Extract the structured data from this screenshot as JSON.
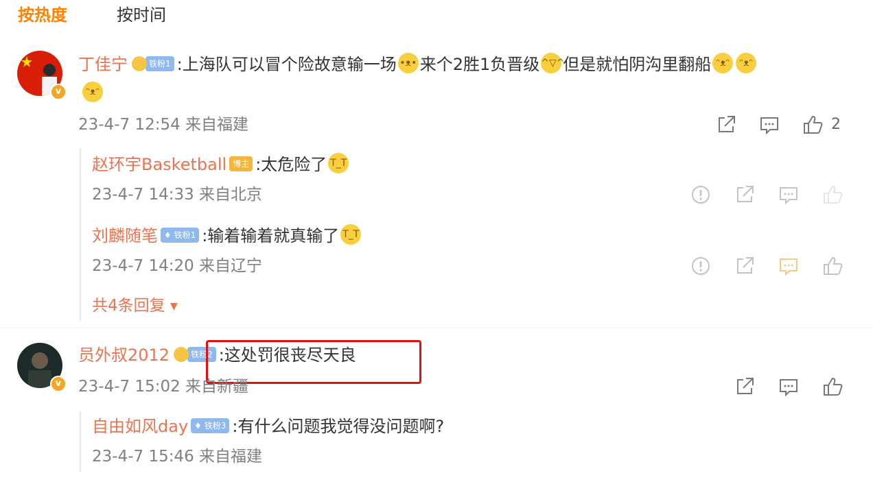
{
  "tabs": {
    "hot": "按热度",
    "time": "按时间"
  },
  "comments": [
    {
      "user": "丁佳宁",
      "badge": "铁粉1",
      "text_parts": [
        ":上海队可以冒个险故意输一场",
        "来个2胜1负晋级",
        "但是就怕阴沟里翻船"
      ],
      "meta": "23-4-7 12:54 来自福建",
      "likes": "2",
      "replies": [
        {
          "user": "赵环宇Basketball",
          "badge": "博主",
          "text": ":太危险了",
          "meta": "23-4-7 14:33 来自北京"
        },
        {
          "user": "刘麟随笔",
          "badge": "铁粉1",
          "text": ":输着输着就真输了",
          "meta": "23-4-7 14:20 来自辽宁"
        }
      ],
      "more_replies": "共4条回复"
    },
    {
      "user": "员外叔2012",
      "badge": "铁粉2",
      "text": ":这处罚很丧尽天良",
      "meta": "23-4-7 15:02 来自新疆",
      "replies": [
        {
          "user": "自由如风day",
          "badge": "铁粉3",
          "text": ":有什么问题我觉得没问题啊?",
          "meta": "23-4-7 15:46 来自福建"
        }
      ]
    }
  ],
  "icons": {
    "share": "share-icon",
    "comment": "comment-icon",
    "like": "like-icon",
    "report": "report-icon",
    "emoji": "emoji-icon"
  },
  "colors": {
    "accent": "#ff8200",
    "username": "#eb7350",
    "highlight_box": "#e01010",
    "badge_blue": "#8fb8ef",
    "badge_orange": "#f4b53f"
  }
}
